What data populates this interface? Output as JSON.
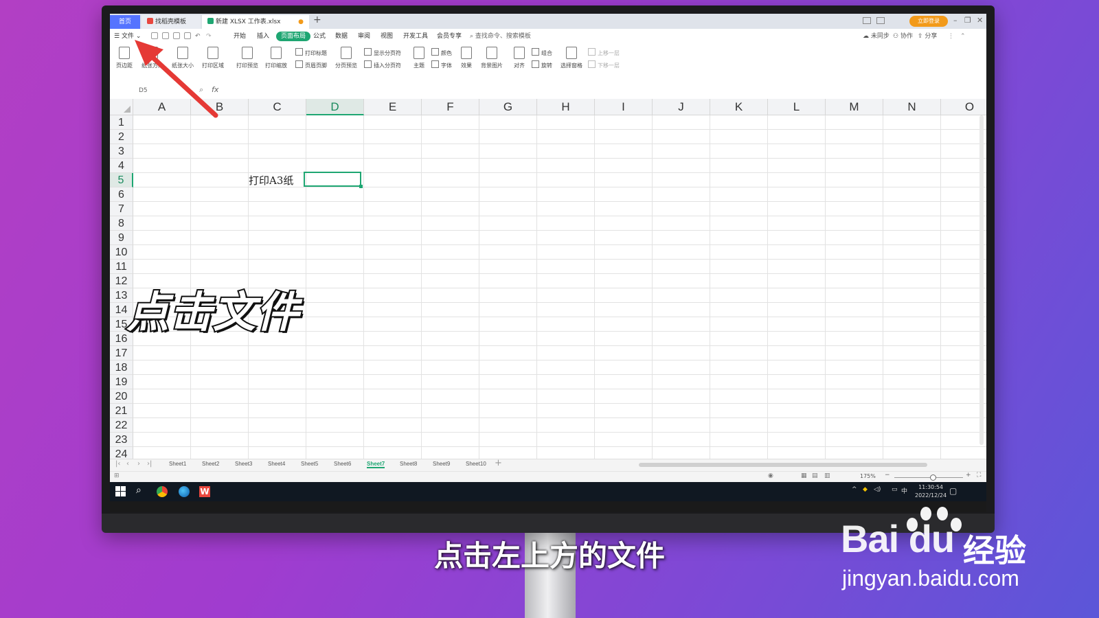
{
  "tabs": {
    "home": "首页",
    "templates": "找稻壳模板",
    "file": "新建 XLSX 工作表.xlsx"
  },
  "title_bar": {
    "login": "立即登录"
  },
  "menu": {
    "file": "文件",
    "items": [
      "开始",
      "插入",
      "页面布局",
      "公式",
      "数据",
      "审阅",
      "视图",
      "开发工具",
      "会员专享"
    ],
    "active": "页面布局",
    "search": "查找命令、搜索模板",
    "right": [
      "未同步",
      "协作",
      "分享"
    ]
  },
  "ribbon": {
    "big": [
      "页边距",
      "纸张方向",
      "纸张大小",
      "打印区域",
      "打印预览",
      "打印缩放",
      "分页预览",
      "主题",
      "效果",
      "背景图片",
      "对齐",
      "选择窗格"
    ],
    "small": [
      "打印标题",
      "页眉页脚",
      "显示分页符",
      "插入分页符",
      "颜色",
      "字体",
      "组合",
      "旋转",
      "上移一层",
      "下移一层"
    ]
  },
  "formula_bar": {
    "name_box": "D5",
    "fx": "fx"
  },
  "grid": {
    "columns": [
      "A",
      "B",
      "C",
      "D",
      "E",
      "F",
      "G",
      "H",
      "I",
      "J",
      "K",
      "L",
      "M",
      "N",
      "O"
    ],
    "rows": [
      "1",
      "2",
      "3",
      "4",
      "5",
      "6",
      "7",
      "8",
      "9",
      "10",
      "11",
      "12",
      "13",
      "14",
      "15",
      "16",
      "17",
      "18",
      "19",
      "20",
      "21",
      "22",
      "23",
      "24"
    ],
    "selected_column": "D",
    "selected_row": "5",
    "cell_c5": "打印A3纸"
  },
  "sheets": [
    "Sheet1",
    "Sheet2",
    "Sheet3",
    "Sheet4",
    "Sheet5",
    "Sheet6",
    "Sheet7",
    "Sheet8",
    "Sheet9",
    "Sheet10"
  ],
  "active_sheet": "Sheet7",
  "status": {
    "zoom": "175%"
  },
  "taskbar": {
    "ime": "中",
    "time": "11:30:54",
    "date": "2022/12/24"
  },
  "overlay": {
    "big_caption": "点击文件",
    "subtitle": "点击左上方的文件"
  },
  "watermark": {
    "brand": "Bai  du",
    "cn": "经验",
    "url": "jingyan.baidu.com"
  },
  "colors": {
    "accent": "#1ea672",
    "arrow": "#e53935",
    "home_tab": "#5574ff",
    "login": "#f29a1a"
  }
}
